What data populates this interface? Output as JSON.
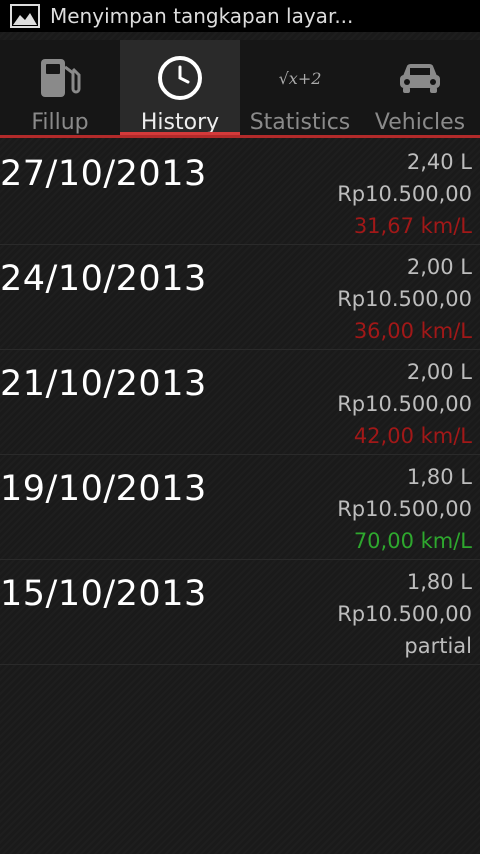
{
  "status_bar": {
    "notification_text": "Menyimpan tangkapan layar...",
    "icon": "screenshot-icon"
  },
  "tabs": [
    {
      "label": "Fillup",
      "icon": "fuel-pump-icon",
      "active": false
    },
    {
      "label": "History",
      "icon": "clock-icon",
      "active": true
    },
    {
      "label": "Statistics",
      "icon": "sqrt-x-plus-2-icon",
      "icon_text": "√x+2",
      "active": false
    },
    {
      "label": "Vehicles",
      "icon": "car-icon",
      "active": false
    }
  ],
  "history": [
    {
      "date": "27/10/2013",
      "litres": "2,40 L",
      "price": "Rp10.500,00",
      "efficiency": "31,67 km/L",
      "status": "bad"
    },
    {
      "date": "24/10/2013",
      "litres": "2,00 L",
      "price": "Rp10.500,00",
      "efficiency": "36,00 km/L",
      "status": "bad"
    },
    {
      "date": "21/10/2013",
      "litres": "2,00 L",
      "price": "Rp10.500,00",
      "efficiency": "42,00 km/L",
      "status": "bad"
    },
    {
      "date": "19/10/2013",
      "litres": "1,80 L",
      "price": "Rp10.500,00",
      "efficiency": "70,00 km/L",
      "status": "good"
    },
    {
      "date": "15/10/2013",
      "litres": "1,80 L",
      "price": "Rp10.500,00",
      "efficiency": "partial",
      "status": "neutral"
    }
  ],
  "colors": {
    "accent": "#d33a3a",
    "bad": "#a11818",
    "good": "#2ea82e",
    "background": "#1a1a1a"
  }
}
